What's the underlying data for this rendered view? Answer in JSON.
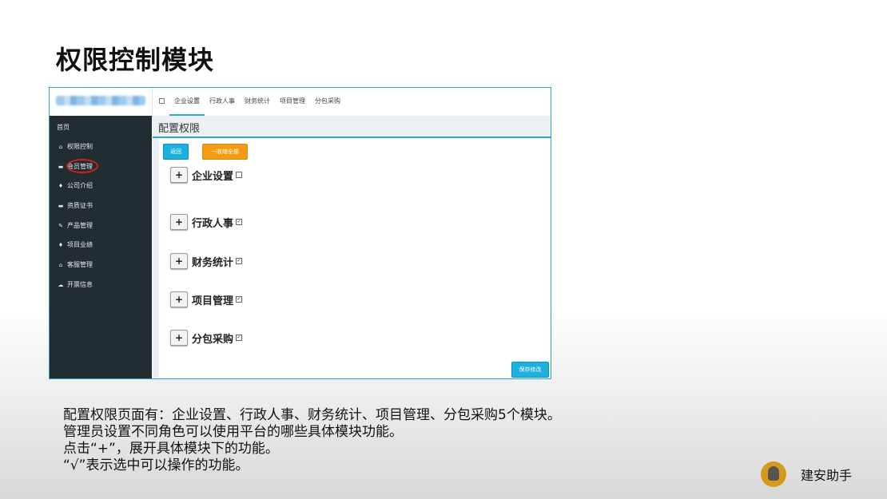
{
  "slide": {
    "title": "权限控制模块",
    "description_lines": [
      "配置权限页面有：企业设置、行政人事、财务统计、项目管理、分包采购5个模块。",
      "管理员设置不同角色可以使用平台的哪些具体模块功能。",
      "点击“+”，展开具体模块下的功能。",
      "“√”表示选中可以操作的功能。"
    ],
    "brand": "建安助手"
  },
  "app": {
    "top_tabs": [
      "企业设置",
      "行政人事",
      "财务统计",
      "项目管理",
      "分包采购"
    ],
    "active_tab": "企业设置",
    "sidebar": [
      {
        "label": "首页",
        "icon": "none"
      },
      {
        "label": "权限控制",
        "icon": "home-icon"
      },
      {
        "label": "会员管理",
        "icon": "comment-icon"
      },
      {
        "label": "公司介绍",
        "icon": "pin-icon"
      },
      {
        "label": "资质证书",
        "icon": "comment-icon"
      },
      {
        "label": "产品管理",
        "icon": "tag-icon"
      },
      {
        "label": "项目业绩",
        "icon": "pin-icon"
      },
      {
        "label": "客服管理",
        "icon": "home-icon"
      },
      {
        "label": "开票信息",
        "icon": "cloud-icon"
      }
    ],
    "page_title": "配置权限",
    "buttons": {
      "back": "返回",
      "collapse_all": "一收缩全部",
      "save": "保存修改"
    },
    "modules": [
      {
        "label": "企业设置",
        "checked": false
      },
      {
        "label": "行政人事",
        "checked": true
      },
      {
        "label": "财务统计",
        "checked": true
      },
      {
        "label": "项目管理",
        "checked": true
      },
      {
        "label": "分包采购",
        "checked": true
      }
    ],
    "colors": {
      "accent": "#2aa6d6",
      "sidebar": "#222d32",
      "warning": "#f39c12",
      "highlight": "#d01f1f"
    }
  }
}
